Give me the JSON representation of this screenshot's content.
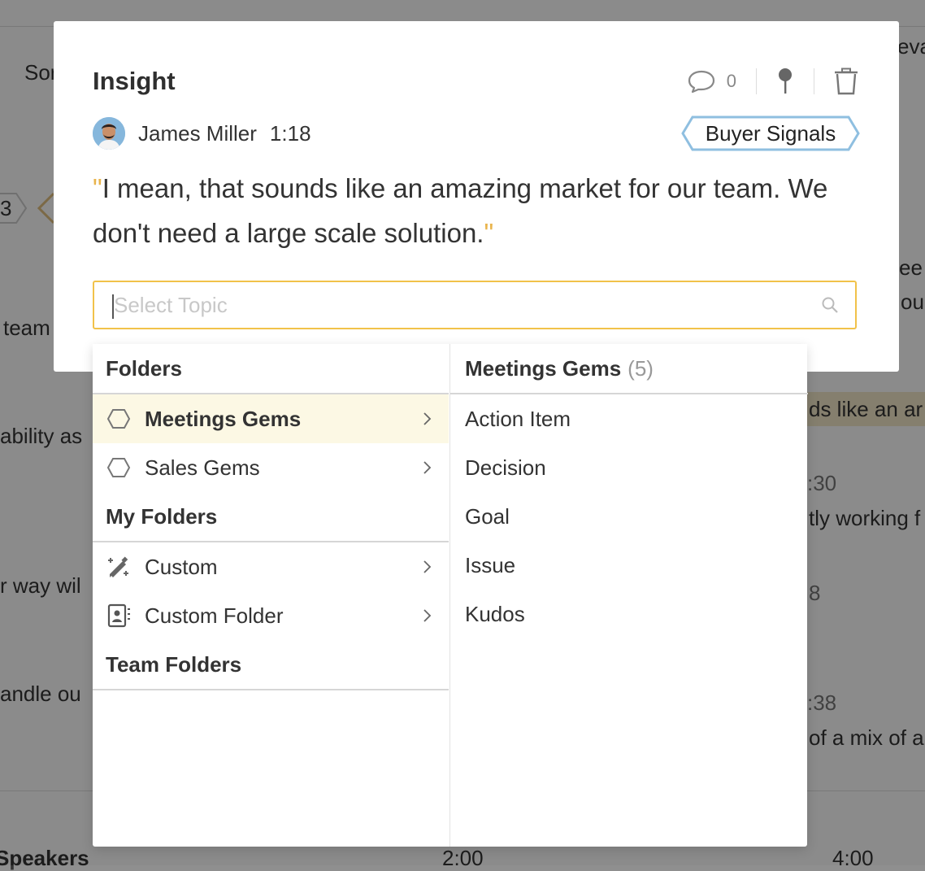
{
  "background": {
    "left_fragments": [
      "Sor",
      "3",
      "team",
      "ability as",
      "r way wil",
      "andle ou"
    ],
    "right_fragments": [
      "eva",
      "ee",
      "ou a",
      "ds like an ar",
      ":30",
      "tly working f",
      "8",
      ":38",
      "of a mix of a"
    ],
    "bottom": {
      "speakers_label": "Speakers",
      "time_a": "2:00",
      "time_b": "4:00"
    }
  },
  "modal": {
    "title": "Insight",
    "comment_count": "0",
    "author": {
      "name": "James Miller",
      "time": "1:18"
    },
    "tag": "Buyer Signals",
    "quote": "I mean, that sounds like an amazing market for our team. We don't need a large scale solution.",
    "quote_open": "\"",
    "quote_close": "\"",
    "topic_placeholder": "Select Topic",
    "topic_value": "",
    "colors": {
      "accent": "#f1c24a",
      "tag_border": "#8fbfe0",
      "quote_mark": "#e9b44c",
      "active_row": "#fcf8e4"
    }
  },
  "dropdown": {
    "folders_heading": "Folders",
    "folders": [
      {
        "label": "Meetings Gems",
        "icon": "hexagon-icon",
        "active": true
      },
      {
        "label": "Sales Gems",
        "icon": "hexagon-icon",
        "active": false
      }
    ],
    "my_folders_heading": "My Folders",
    "my_folders": [
      {
        "label": "Custom",
        "icon": "magic-pencil-icon"
      },
      {
        "label": "Custom Folder",
        "icon": "contact-card-icon"
      }
    ],
    "team_folders_heading": "Team Folders",
    "detail": {
      "title": "Meetings Gems",
      "count": "(5)",
      "items": [
        "Action Item",
        "Decision",
        "Goal",
        "Issue",
        "Kudos"
      ]
    }
  }
}
